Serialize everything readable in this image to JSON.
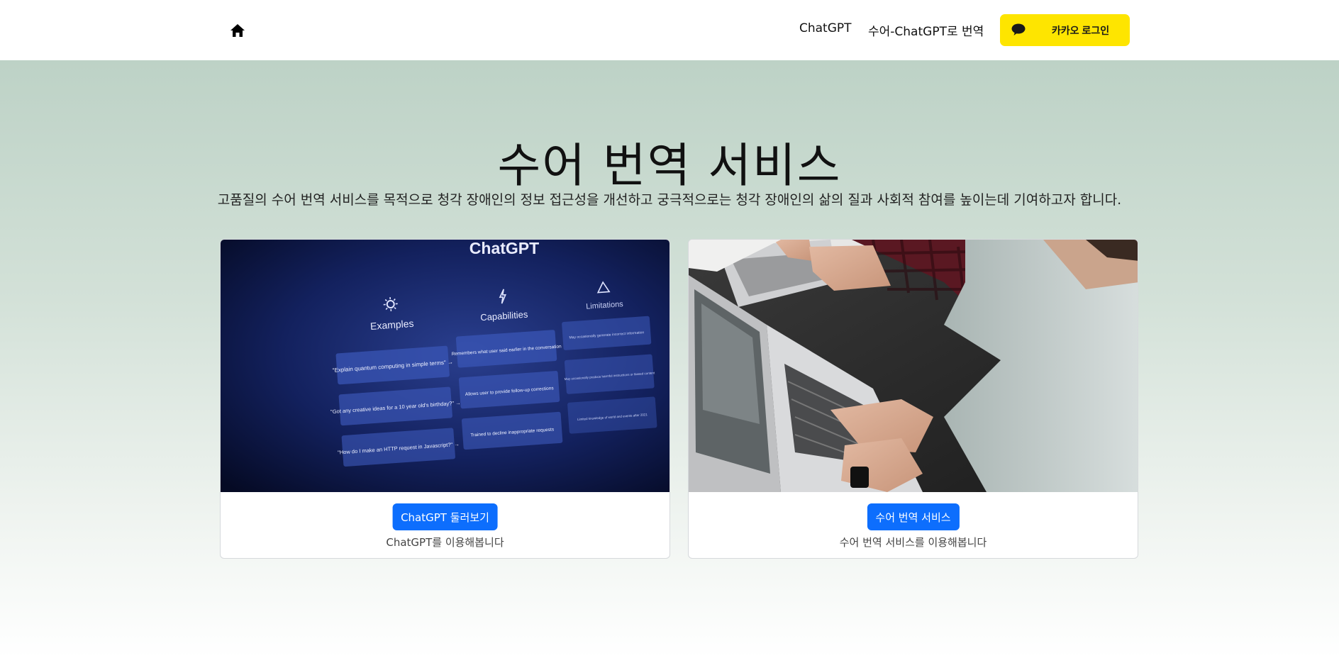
{
  "nav": {
    "home_icon": "home-icon",
    "links": [
      "ChatGPT",
      "수어-ChatGPT로 번역"
    ],
    "kakao_login_label": "카카오 로그인",
    "kakao_icon": "speech-bubble-icon",
    "kakao_color": "#fee500"
  },
  "hero": {
    "title": "수어 번역 서비스",
    "subtitle": "고품질의 수어 번역 서비스를 목적으로 청각 장애인의 정보 접근성을 개선하고 궁극적으로는 청각 장애인의 삶의 질과 사회적 참여를 높이는데 기여하고자 합니다."
  },
  "cards": [
    {
      "button_label": "ChatGPT 둘러보기",
      "description": "ChatGPT를 이용해봅니다",
      "image": {
        "title": "ChatGPT",
        "columns": [
          {
            "heading": "Examples",
            "icon": "sun-icon",
            "items": [
              "\"Explain quantum computing in simple terms\" →",
              "\"Got any creative ideas for a 10 year old's birthday?\" →",
              "\"How do I make an HTTP request in Javascript?\" →"
            ]
          },
          {
            "heading": "Capabilities",
            "icon": "lightning-icon",
            "items": [
              "Remembers what user said earlier in the conversation",
              "Allows user to provide follow-up corrections",
              "Trained to decline inappropriate requests"
            ]
          },
          {
            "heading": "Limitations",
            "icon": "warning-icon",
            "items": [
              "May occasionally generate incorrect information",
              "May occasionally produce harmful instructions or biased content",
              "Limited knowledge of world and events after 2021"
            ]
          }
        ]
      }
    },
    {
      "button_label": "수어 번역 서비스",
      "description": "수어 번역 서비스를 이용해봅니다",
      "image": {
        "subject": "people-typing-on-laptops"
      }
    }
  ],
  "colors": {
    "primary_button": "#0d6efd",
    "hero_gradient_top": "#bdd2c6"
  }
}
